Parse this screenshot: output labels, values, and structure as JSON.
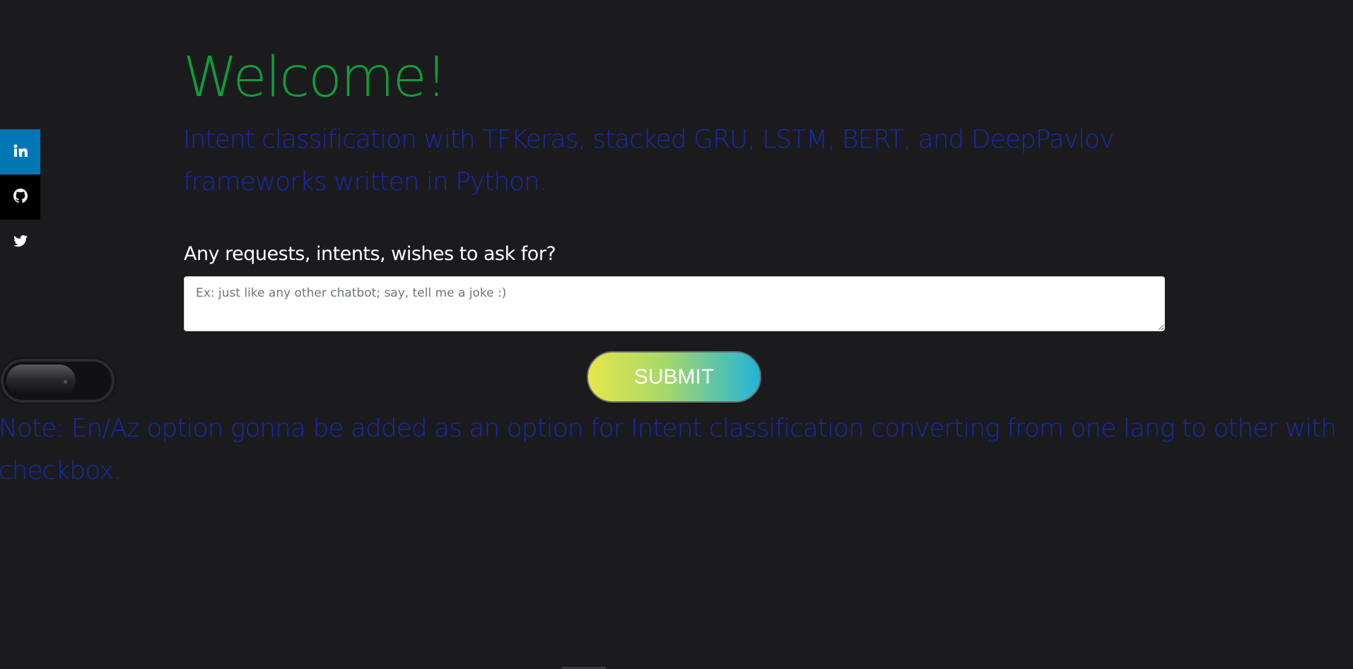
{
  "social": {
    "items": [
      {
        "name": "linkedin",
        "icon": "linkedin-icon",
        "color": "#0077b5"
      },
      {
        "name": "github",
        "icon": "github-icon",
        "color": "#000000"
      },
      {
        "name": "twitter",
        "icon": "twitter-icon",
        "color": "transparent"
      }
    ]
  },
  "hero": {
    "title": "Welcome!",
    "subtitle": "Intent classification with TFKeras, stacked GRU, LSTM, BERT, and DeepPavlov frameworks written in Python."
  },
  "form": {
    "label": "Any requests, intents, wishes to ask for?",
    "input_placeholder": "Ex: just like any other chatbot; say, tell me a joke :)",
    "input_value": "",
    "submit_label": "SUBMIT"
  },
  "toggle": {
    "state": "off"
  },
  "note": {
    "text": "Note: En/Az option gonna be added as an option for Intent classification converting from one lang to other with checkbox."
  },
  "colors": {
    "background": "#1b1b1e",
    "title": "#0f9d3a",
    "subtitle": "#1a2aa8",
    "linkedin": "#0077b5"
  }
}
